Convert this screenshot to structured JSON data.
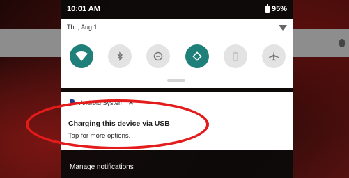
{
  "status_bar": {
    "time": "10:01 AM",
    "battery": "95%"
  },
  "quick_settings": {
    "date": "Thu, Aug 1",
    "tiles": [
      {
        "icon": "wifi-icon",
        "active": true
      },
      {
        "icon": "bluetooth-icon",
        "active": false
      },
      {
        "icon": "do-not-disturb-icon",
        "active": false
      },
      {
        "icon": "auto-rotate-icon",
        "active": true
      },
      {
        "icon": "battery-saver-icon",
        "active": false
      },
      {
        "icon": "airplane-mode-icon",
        "active": false
      }
    ]
  },
  "notification": {
    "app_name": "Android System",
    "title": "Charging this device via USB",
    "text": "Tap for more options."
  },
  "footer": {
    "manage": "Manage notifications"
  },
  "colors": {
    "accent": "#1f7f79",
    "highlight_circle": "#e31b1b"
  }
}
